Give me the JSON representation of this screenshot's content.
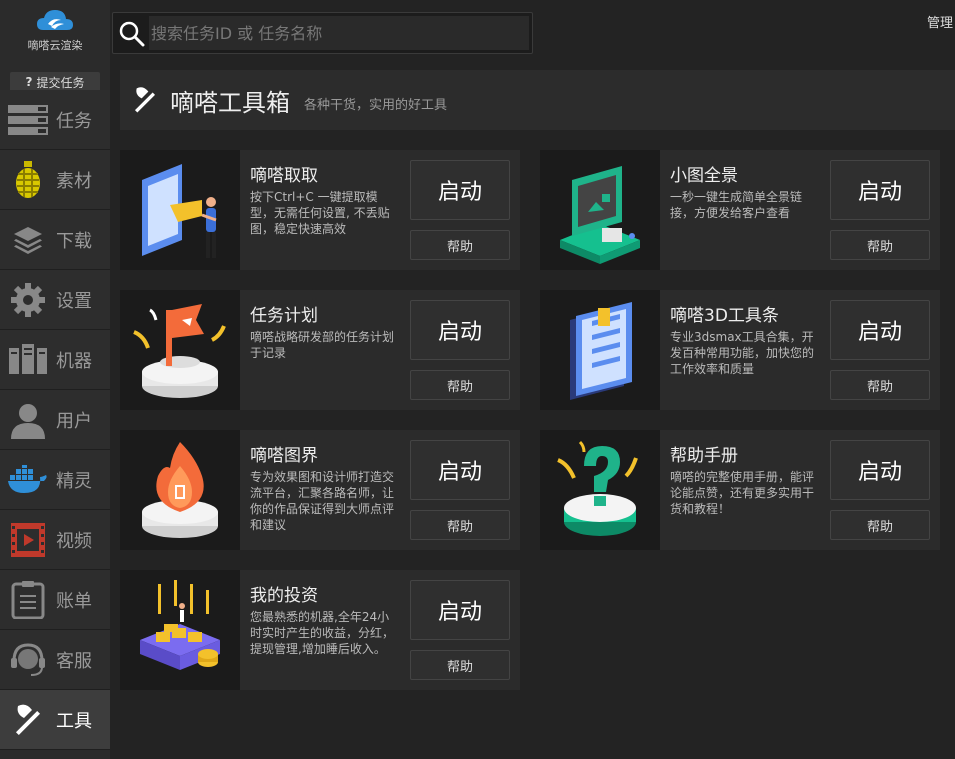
{
  "app": {
    "logo_text": "嘀嗒云渲染",
    "submit_label": "提交任务",
    "manage_label": "管理"
  },
  "search": {
    "placeholder": "搜索任务ID 或 任务名称",
    "value": ""
  },
  "sidebar": {
    "items": [
      {
        "label": "任务",
        "icon": "server-stack-icon"
      },
      {
        "label": "素材",
        "icon": "grenade-icon"
      },
      {
        "label": "下载",
        "icon": "layers-icon"
      },
      {
        "label": "设置",
        "icon": "gear-icon"
      },
      {
        "label": "机器",
        "icon": "machines-icon"
      },
      {
        "label": "用户",
        "icon": "user-icon"
      },
      {
        "label": "精灵",
        "icon": "whale-icon"
      },
      {
        "label": "视频",
        "icon": "video-icon"
      },
      {
        "label": "账单",
        "icon": "bill-icon"
      },
      {
        "label": "客服",
        "icon": "headset-icon"
      },
      {
        "label": "工具",
        "icon": "axe-icon",
        "active": true
      }
    ]
  },
  "header": {
    "title": "嘀嗒工具箱",
    "subtitle": "各种干货，实用的好工具"
  },
  "tools": [
    {
      "title": "嘀嗒取取",
      "description": "按下Ctrl+C 一键提取模型，无需任何设置, 不丢贴图，稳定快速高效",
      "start_label": "启动",
      "help_label": "帮助",
      "icon": "extract-illustration"
    },
    {
      "title": "小图全景",
      "description": "一秒一键生成简单全景链接，方便发给客户查看",
      "start_label": "启动",
      "help_label": "帮助",
      "icon": "panorama-illustration"
    },
    {
      "title": "任务计划",
      "description": "嘀嗒战略研发部的任务计划于记录",
      "start_label": "启动",
      "help_label": "帮助",
      "icon": "flag-illustration"
    },
    {
      "title": "嘀嗒3D工具条",
      "description": "专业3dsmax工具合集，开发百种常用功能，加快您的工作效率和质量",
      "start_label": "启动",
      "help_label": "帮助",
      "icon": "notebook-illustration"
    },
    {
      "title": "嘀嗒图界",
      "description": "专为效果图和设计师打造交流平台，汇聚各路名师，让你的作品保证得到大师点评和建议",
      "start_label": "启动",
      "help_label": "帮助",
      "icon": "flame-illustration"
    },
    {
      "title": "帮助手册",
      "description": "嘀嗒的完整使用手册，能评论能点赞，还有更多实用干货和教程！",
      "start_label": "启动",
      "help_label": "帮助",
      "icon": "question-illustration"
    },
    {
      "title": "我的投资",
      "description": "您最熟悉的机器,全年24小时实时产生的收益，分红，提现管理,增加睡后收入。",
      "start_label": "启动",
      "help_label": "帮助",
      "icon": "investment-illustration"
    }
  ],
  "colors": {
    "background": "#232323",
    "sidebar": "#2b2b2b",
    "accent_blue": "#2f8fd8",
    "accent_green": "#1fb38a",
    "accent_orange": "#f36b3a",
    "accent_yellow": "#f3c12b"
  }
}
